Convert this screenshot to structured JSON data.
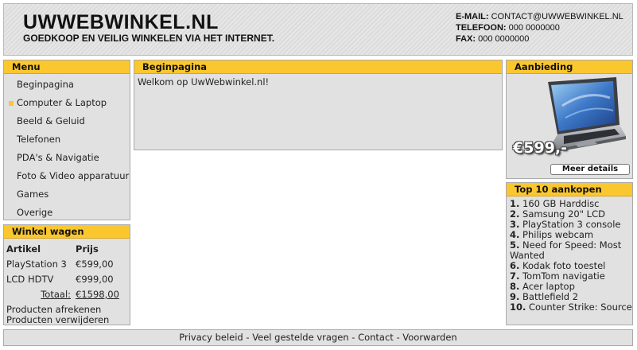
{
  "header": {
    "title": "UWWEBWINKEL.NL",
    "tagline": "GOEDKOOP EN VEILIG WINKELEN VIA HET INTERNET.",
    "email_label": "E-MAIL:",
    "email_value": "CONTACT@UWWEBWINKEL.NL",
    "phone_label": "TELEFOON:",
    "phone_value": "000 0000000",
    "fax_label": "FAX:",
    "fax_value": "000 0000000"
  },
  "menu": {
    "title": "Menu",
    "items": [
      {
        "label": "Beginpagina"
      },
      {
        "label": "Computer & Laptop"
      },
      {
        "label": "Beeld & Geluid"
      },
      {
        "label": "Telefonen"
      },
      {
        "label": "PDA's & Navigatie"
      },
      {
        "label": "Foto & Video apparatuur"
      },
      {
        "label": "Games"
      },
      {
        "label": "Overige"
      }
    ]
  },
  "cart": {
    "title": "Winkel wagen",
    "col_article": "Artikel",
    "col_price": "Prijs",
    "rows": [
      {
        "article": "PlayStation 3",
        "price": "€599,00"
      },
      {
        "article": "LCD HDTV",
        "price": "€999,00"
      }
    ],
    "total_label": "Totaal:",
    "total_value": "€1598,00",
    "checkout_label": "Producten afrekenen",
    "remove_label": "Producten verwijderen"
  },
  "main": {
    "title": "Beginpagina",
    "welcome": "Welkom op UwWebwinkel.nl!"
  },
  "offer": {
    "title": "Aanbieding",
    "price": "€599,-",
    "details_label": "Meer details"
  },
  "top10": {
    "title": "Top 10 aankopen",
    "items": [
      {
        "rank": "1.",
        "name": "160 GB Harddisc"
      },
      {
        "rank": "2.",
        "name": "Samsung 20\" LCD"
      },
      {
        "rank": "3.",
        "name": "PlayStation 3 console"
      },
      {
        "rank": "4.",
        "name": "Philips webcam"
      },
      {
        "rank": "5.",
        "name": "Need for Speed: Most Wanted"
      },
      {
        "rank": "6.",
        "name": "Kodak foto toestel"
      },
      {
        "rank": "7.",
        "name": "TomTom navigatie"
      },
      {
        "rank": "8.",
        "name": "Acer laptop"
      },
      {
        "rank": "9.",
        "name": "Battlefield 2"
      },
      {
        "rank": "10.",
        "name": "Counter Strike: Source"
      }
    ]
  },
  "footer": {
    "privacy": "Privacy beleid",
    "faq": "Veel gestelde vragen",
    "contact": "Contact",
    "terms": "Voorwarden",
    "separator": " - "
  },
  "colors": {
    "accent": "#fbc72e",
    "panel": "#e1e1e1",
    "border": "#aaaaaa"
  }
}
